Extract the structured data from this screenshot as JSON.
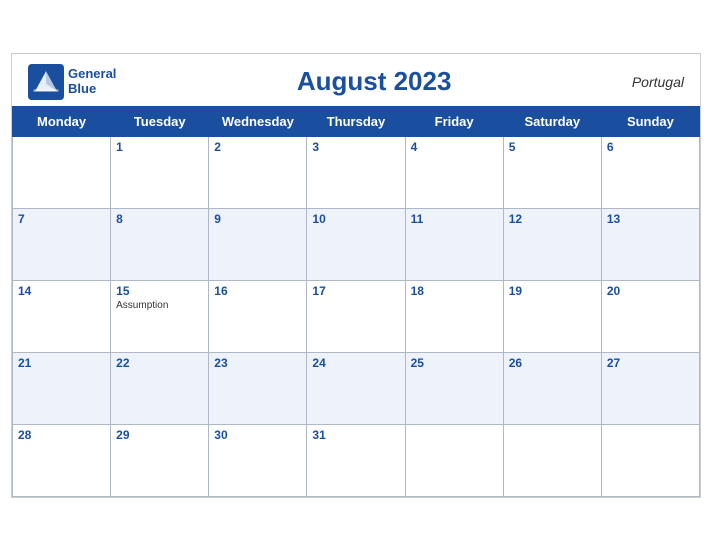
{
  "header": {
    "logo_line1": "General",
    "logo_line2": "Blue",
    "title": "August 2023",
    "country": "Portugal"
  },
  "weekdays": [
    "Monday",
    "Tuesday",
    "Wednesday",
    "Thursday",
    "Friday",
    "Saturday",
    "Sunday"
  ],
  "weeks": [
    [
      {
        "day": "",
        "empty": true
      },
      {
        "day": "1"
      },
      {
        "day": "2"
      },
      {
        "day": "3"
      },
      {
        "day": "4"
      },
      {
        "day": "5"
      },
      {
        "day": "6"
      }
    ],
    [
      {
        "day": "7"
      },
      {
        "day": "8"
      },
      {
        "day": "9"
      },
      {
        "day": "10"
      },
      {
        "day": "11"
      },
      {
        "day": "12"
      },
      {
        "day": "13"
      }
    ],
    [
      {
        "day": "14"
      },
      {
        "day": "15",
        "holiday": "Assumption"
      },
      {
        "day": "16"
      },
      {
        "day": "17"
      },
      {
        "day": "18"
      },
      {
        "day": "19"
      },
      {
        "day": "20"
      }
    ],
    [
      {
        "day": "21"
      },
      {
        "day": "22"
      },
      {
        "day": "23"
      },
      {
        "day": "24"
      },
      {
        "day": "25"
      },
      {
        "day": "26"
      },
      {
        "day": "27"
      }
    ],
    [
      {
        "day": "28"
      },
      {
        "day": "29"
      },
      {
        "day": "30"
      },
      {
        "day": "31"
      },
      {
        "day": "",
        "empty": true
      },
      {
        "day": "",
        "empty": true
      },
      {
        "day": "",
        "empty": true
      }
    ]
  ]
}
